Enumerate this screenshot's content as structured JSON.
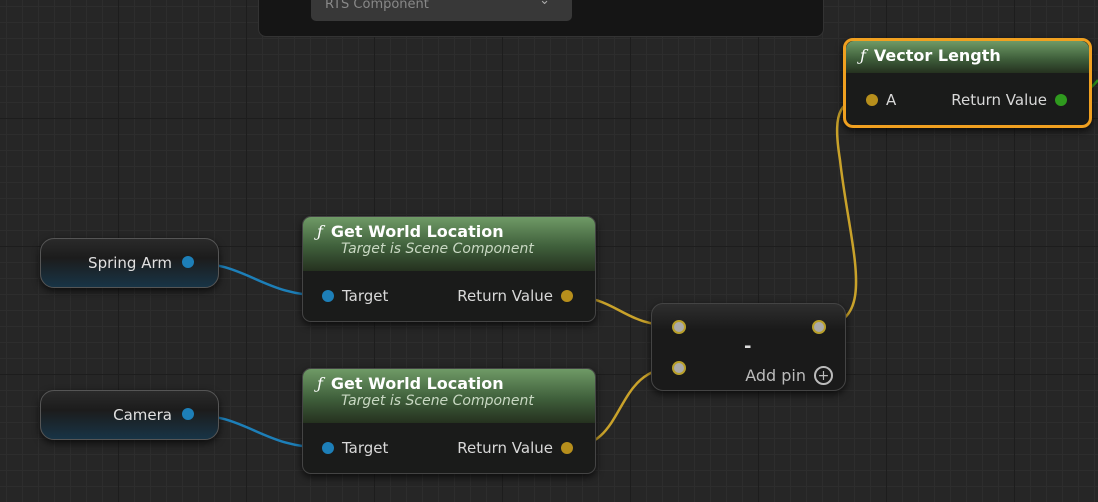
{
  "top_panel": {
    "dropdown_value": "RTS Component"
  },
  "nodes": {
    "vector_length": {
      "title": "Vector Length",
      "pin_in": "A",
      "pin_out": "Return Value"
    },
    "spring_arm": {
      "label": "Spring Arm"
    },
    "camera": {
      "label": "Camera"
    },
    "gwl1": {
      "title": "Get World Location",
      "subtitle": "Target is Scene Component",
      "pin_in": "Target",
      "pin_out": "Return Value"
    },
    "gwl2": {
      "title": "Get World Location",
      "subtitle": "Target is Scene Component",
      "pin_in": "Target",
      "pin_out": "Return Value"
    },
    "subtract": {
      "operator": "-",
      "add_pin": "Add pin"
    }
  },
  "function_symbol": "ƒ",
  "colors": {
    "exec_blue": "#1d7fb8",
    "vector_gold": "#b78f1c",
    "float_green": "#2f9a1e",
    "selected_orange": "#f0a020"
  }
}
